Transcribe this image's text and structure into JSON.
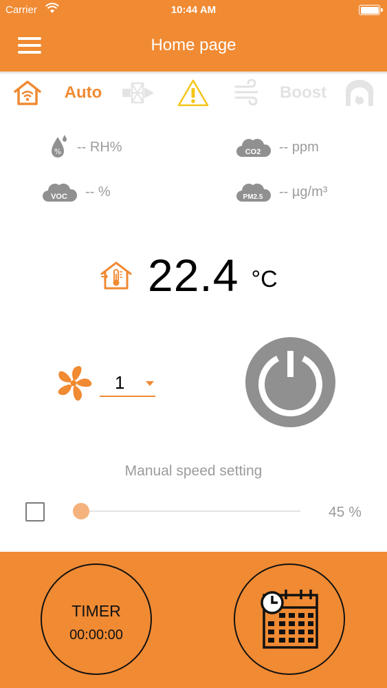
{
  "status_bar": {
    "carrier": "Carrier",
    "time": "10:44 AM",
    "icons": [
      "wifi-icon",
      "battery-icon"
    ]
  },
  "header": {
    "title": "Home page",
    "menu_icon": "hamburger-menu-icon"
  },
  "modes": {
    "auto_label": "Auto",
    "boost_label": "Boost",
    "icons": [
      "home-wifi-icon",
      "airflow-filter-icon",
      "warning-icon",
      "wind-icon",
      "fireplace-icon"
    ],
    "active_color": "#f08a33",
    "warning_color": "#f5c518",
    "inactive_color": "#e2e2e2"
  },
  "sensors": {
    "humidity": {
      "icon": "humidity-drop-icon",
      "value": "-- RH%"
    },
    "co2": {
      "icon": "co2-cloud-icon",
      "icon_text": "CO2",
      "value": "-- ppm"
    },
    "voc": {
      "icon": "voc-cloud-icon",
      "icon_text": "VOC",
      "value": "-- %"
    },
    "pm25": {
      "icon": "pm25-cloud-icon",
      "icon_text": "PM2.5",
      "value": "-- µg/m³"
    }
  },
  "temperature": {
    "icon": "house-thermometer-icon",
    "value": "22.4",
    "unit": "°C"
  },
  "fan": {
    "icon": "fan-icon",
    "speed": "1"
  },
  "power": {
    "icon": "power-icon"
  },
  "manual": {
    "label": "Manual speed setting",
    "checked": false,
    "slider_value_percent": 45,
    "percent_text": "45 %"
  },
  "timer": {
    "label": "TIMER",
    "time": "00:00:00"
  },
  "schedule": {
    "icon": "calendar-clock-icon"
  },
  "colors": {
    "brand": "#f08a33",
    "sensor_gray": "#9b9b9b",
    "power_gray": "#909090"
  }
}
